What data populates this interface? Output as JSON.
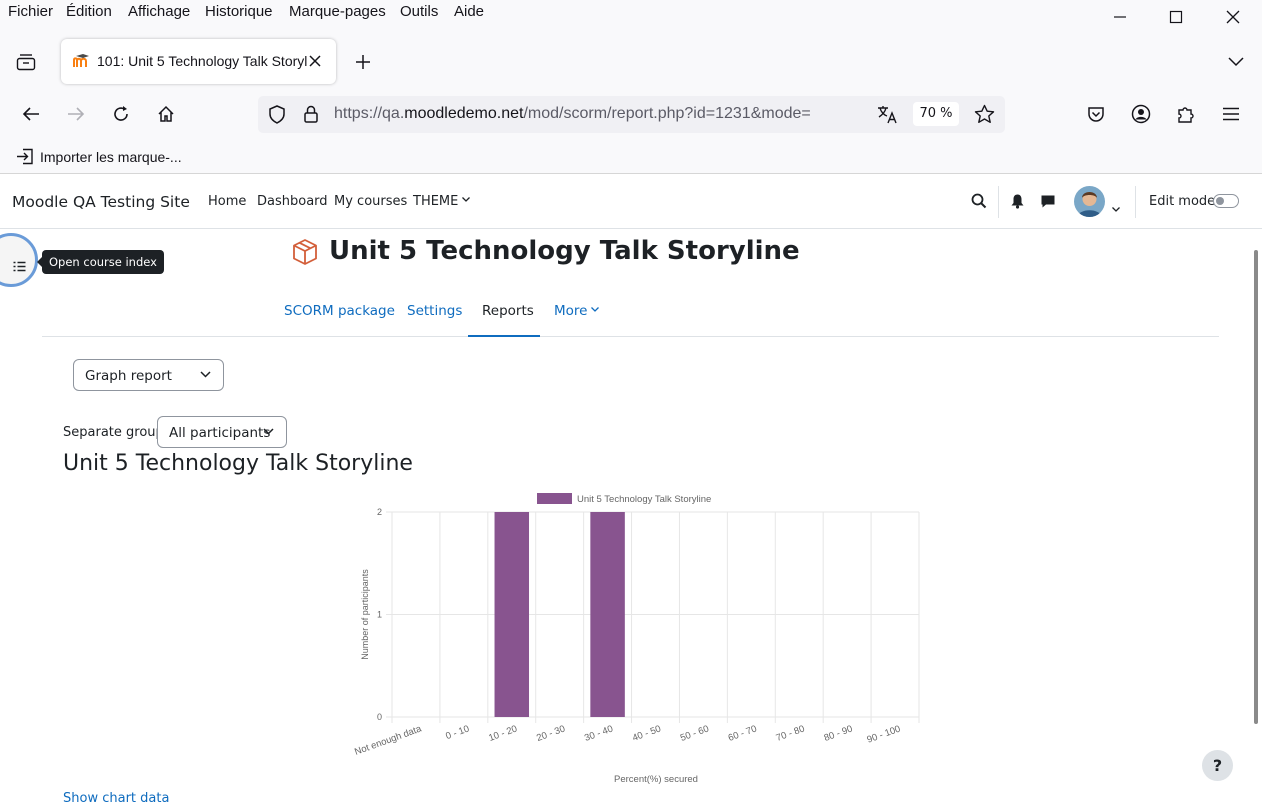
{
  "menu": [
    "Fichier",
    "Édition",
    "Affichage",
    "Historique",
    "Marque-pages",
    "Outils",
    "Aide"
  ],
  "tab": {
    "title": "101: Unit 5 Technology Talk Storyline"
  },
  "url": {
    "prefix": "https://qa.",
    "domain": "moodledemo.net",
    "path": "/mod/scorm/report.php?id=1231&mode="
  },
  "zoom": "70 %",
  "bookmarks": {
    "import_label": "Importer les marque-..."
  },
  "moodle": {
    "site_name": "Moodle QA Testing Site",
    "nav": {
      "home": "Home",
      "dashboard": "Dashboard",
      "my_courses": "My courses",
      "theme": "THEME"
    },
    "edit_mode": "Edit mode",
    "course_index_tooltip": "Open course index",
    "page_title": "Unit 5 Technology Talk Storyline",
    "tabs": {
      "scorm": "SCORM package",
      "settings": "Settings",
      "reports": "Reports",
      "more": "More"
    },
    "report_select": "Graph report",
    "groups_label": "Separate groups",
    "groups_select": "All participants",
    "report_heading": "Unit 5 Technology Talk Storyline",
    "show_chart_data": "Show chart data",
    "help": "?"
  },
  "colors": {
    "accent": "#0f6cbf",
    "bar": "#88548f"
  },
  "chart_data": {
    "type": "bar",
    "categories": [
      "Not enough data",
      "0 - 10",
      "10 - 20",
      "20 - 30",
      "30 - 40",
      "40 - 50",
      "50 - 60",
      "60 - 70",
      "70 - 80",
      "80 - 90",
      "90 - 100"
    ],
    "series": [
      {
        "name": "Unit 5 Technology Talk Storyline",
        "values": [
          0,
          0,
          2,
          0,
          2,
          0,
          0,
          0,
          0,
          0,
          0
        ]
      }
    ],
    "xlabel": "Percent(%) secured",
    "ylabel": "Number of participants",
    "ylim": [
      0,
      2
    ],
    "yticks": [
      0,
      1,
      2
    ],
    "grid": true,
    "legend": "top"
  }
}
